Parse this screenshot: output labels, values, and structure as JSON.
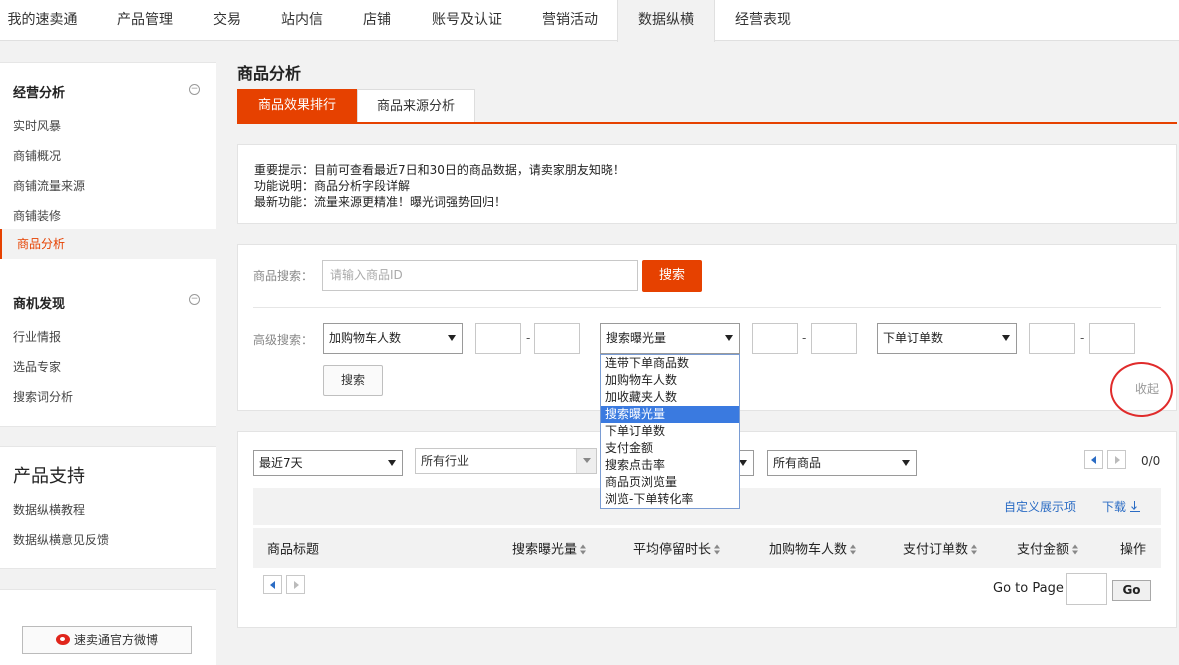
{
  "topnav": {
    "tabs": [
      {
        "label": "我的速卖通",
        "active": false
      },
      {
        "label": "产品管理",
        "active": false
      },
      {
        "label": "交易",
        "active": false
      },
      {
        "label": "站内信",
        "active": false
      },
      {
        "label": "店铺",
        "active": false
      },
      {
        "label": "账号及认证",
        "active": false
      },
      {
        "label": "营销活动",
        "active": false
      },
      {
        "label": "数据纵横",
        "active": true
      },
      {
        "label": "经营表现",
        "active": false
      }
    ]
  },
  "sidebar": {
    "section1": {
      "title": "经营分析",
      "items": [
        "实时风暴",
        "商铺概况",
        "商铺流量来源",
        "商铺装修",
        "商品分析"
      ],
      "active_item": "商品分析"
    },
    "section2": {
      "title": "商机发现",
      "items": [
        "行业情报",
        "选品专家",
        "搜索词分析"
      ]
    },
    "support": {
      "title": "产品支持",
      "items": [
        "数据纵横教程",
        "数据纵横意见反馈"
      ]
    },
    "weibo_button": "速卖通官方微博"
  },
  "main": {
    "page_title": "商品分析",
    "tabs": [
      {
        "label": "商品效果排行",
        "active": true
      },
      {
        "label": "商品来源分析",
        "active": false
      }
    ],
    "notice": {
      "line1": "重要提示：目前可查看最近7日和30日的商品数据，请卖家朋友知晓！",
      "line2": "功能说明：商品分析字段详解",
      "line3": "最新功能：流量来源更精准！曝光词强势回归！"
    },
    "search": {
      "label": "商品搜索：",
      "placeholder": "请输入商品ID",
      "button": "搜索"
    },
    "advanced": {
      "label": "高级搜索：",
      "select1": "加购物车人数",
      "select2": "搜索曝光量",
      "select3": "下单订单数",
      "dash": "-",
      "search_button": "搜索",
      "collapse_link": "收起"
    },
    "dropdown_options": [
      "连带下单商品数",
      "加购物车人数",
      "加收藏夹人数",
      "搜索曝光量",
      "下单订单数",
      "支付金额",
      "搜索点击率",
      "商品页浏览量",
      "浏览-下单转化率"
    ],
    "dropdown_selected": "搜索曝光量",
    "filters": {
      "period": "最近7天",
      "industry": "所有行业",
      "products": "所有商品"
    },
    "pager_count": "0/0",
    "toolbar": {
      "custom_columns": "自定义展示项",
      "download": "下载"
    },
    "table_headers": [
      "商品标题",
      "搜索曝光量",
      "平均停留时长",
      "加购物车人数",
      "支付订单数",
      "支付金额",
      "操作"
    ],
    "goto": {
      "label": "Go to Page",
      "button": "Go"
    }
  },
  "colors": {
    "accent": "#e64100",
    "link": "#2b6cc4",
    "highlight": "#3a7ae0",
    "annotation": "#e02b2b"
  }
}
